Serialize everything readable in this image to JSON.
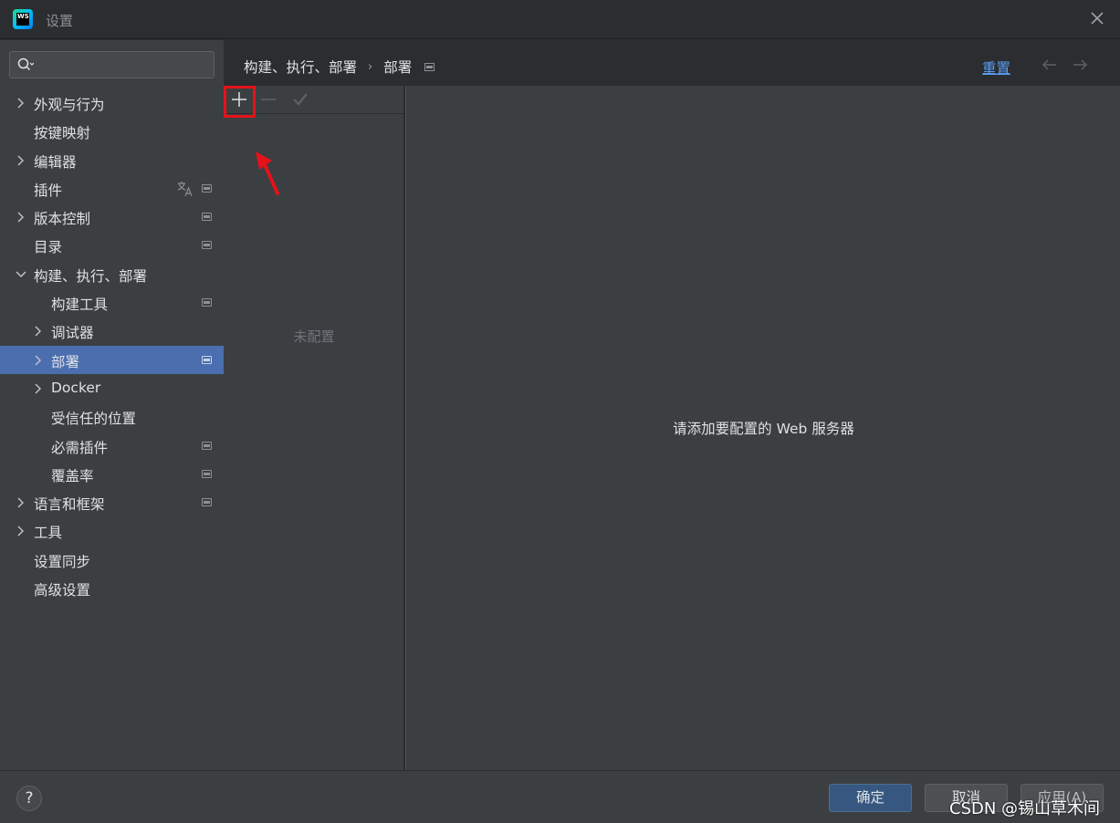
{
  "window": {
    "title": "设置",
    "app_icon": "webstorm-icon",
    "app_icon_text": "WS"
  },
  "search": {
    "value": "",
    "placeholder": ""
  },
  "sidebar": {
    "items": [
      {
        "label": "外观与行为",
        "level": 0,
        "expandable": true,
        "expanded": false,
        "badge": false
      },
      {
        "label": "按键映射",
        "level": 0,
        "expandable": false,
        "badge": false
      },
      {
        "label": "编辑器",
        "level": 0,
        "expandable": true,
        "expanded": false,
        "badge": false
      },
      {
        "label": "插件",
        "level": 0,
        "expandable": false,
        "badge": true,
        "translate": true
      },
      {
        "label": "版本控制",
        "level": 0,
        "expandable": true,
        "expanded": false,
        "badge": true
      },
      {
        "label": "目录",
        "level": 0,
        "expandable": false,
        "badge": true
      },
      {
        "label": "构建、执行、部署",
        "level": 0,
        "expandable": true,
        "expanded": true,
        "badge": false
      },
      {
        "label": "构建工具",
        "level": 1,
        "expandable": false,
        "badge": true
      },
      {
        "label": "调试器",
        "level": 1,
        "expandable": true,
        "expanded": false,
        "badge": false
      },
      {
        "label": "部署",
        "level": 1,
        "expandable": true,
        "expanded": false,
        "badge": true,
        "selected": true
      },
      {
        "label": "Docker",
        "level": 1,
        "expandable": true,
        "expanded": false,
        "badge": false
      },
      {
        "label": "受信任的位置",
        "level": 1,
        "expandable": false,
        "badge": false
      },
      {
        "label": "必需插件",
        "level": 1,
        "expandable": false,
        "badge": true
      },
      {
        "label": "覆盖率",
        "level": 1,
        "expandable": false,
        "badge": true
      },
      {
        "label": "语言和框架",
        "level": 0,
        "expandable": true,
        "expanded": false,
        "badge": true
      },
      {
        "label": "工具",
        "level": 0,
        "expandable": true,
        "expanded": false,
        "badge": false
      },
      {
        "label": "设置同步",
        "level": 0,
        "expandable": false,
        "badge": false
      },
      {
        "label": "高级设置",
        "level": 0,
        "expandable": false,
        "badge": false
      }
    ]
  },
  "breadcrumb": {
    "parent": "构建、执行、部署",
    "separator": "›",
    "current": "部署"
  },
  "header": {
    "reset_label": "重置",
    "back_icon": "arrow-left-icon",
    "forward_icon": "arrow-right-icon"
  },
  "toolbar": {
    "add_icon": "plus-icon",
    "remove_icon": "minus-icon",
    "apply_icon": "check-icon"
  },
  "list_panel": {
    "empty_text": "未配置"
  },
  "detail_panel": {
    "message": "请添加要配置的 Web 服务器"
  },
  "footer": {
    "help_label": "?",
    "ok_label": "确定",
    "cancel_label": "取消",
    "apply_label": "应用(A)",
    "watermark": "CSDN @锡山草木间"
  },
  "colors": {
    "accent": "#4b6eaf",
    "link": "#589df6",
    "annotation": "#e3121b",
    "primary_button": "#365880"
  }
}
